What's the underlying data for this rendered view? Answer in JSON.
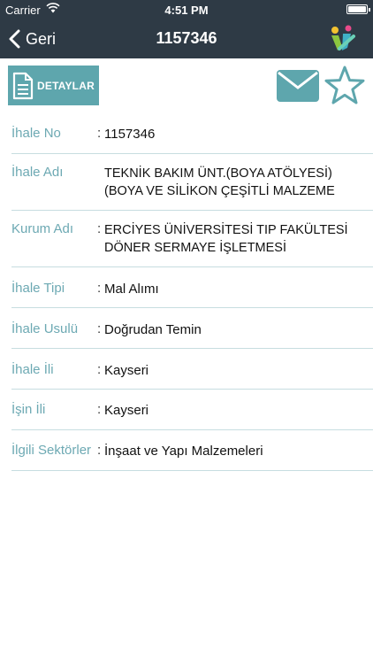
{
  "status_bar": {
    "carrier": "Carrier",
    "time": "4:51 PM"
  },
  "nav": {
    "back_label": "Geri",
    "title": "1157346",
    "logo_icon": "app-logo-icon"
  },
  "toolbar": {
    "details_label": "DETAYLAR",
    "details_icon": "document-icon",
    "mail_icon": "mail-icon",
    "favorite_icon": "star-icon",
    "accent_color": "#5ea6ad"
  },
  "fields": [
    {
      "label": "İhale No",
      "colon": ":",
      "value": "1157346"
    },
    {
      "label": "İhale Adı",
      "colon": "",
      "value_line1": "TEKNİK BAKIM ÜNT.(BOYA ATÖLYESİ)",
      "value_line2": "(BOYA VE SİLİKON ÇEŞİTLİ MALZEME"
    },
    {
      "label": "Kurum Adı",
      "colon": ":",
      "value_line1": "ERCİYES ÜNİVERSİTESİ TIP FAKÜLTESİ",
      "value_line2": "DÖNER SERMAYE İŞLETMESİ"
    },
    {
      "label": "İhale Tipi",
      "colon": ":",
      "value": "Mal Alımı"
    },
    {
      "label": "İhale Usulü",
      "colon": ":",
      "value": "Doğrudan Temin"
    },
    {
      "label": "İhale İli",
      "colon": ":",
      "value": "Kayseri"
    },
    {
      "label": "İşin İli",
      "colon": ":",
      "value": "Kayseri"
    },
    {
      "label": "İlgili Sektörler",
      "colon": ":",
      "value": "İnşaat ve Yapı Malzemeleri"
    }
  ]
}
